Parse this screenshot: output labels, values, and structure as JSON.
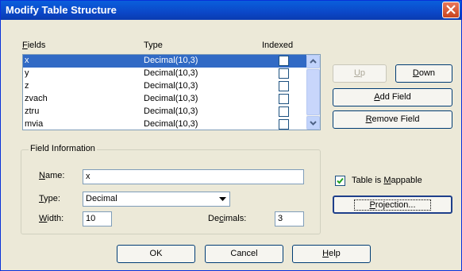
{
  "window": {
    "title": "Modify Table Structure"
  },
  "headers": {
    "fields": "Fields",
    "type": "Type",
    "indexed": "Indexed"
  },
  "fields": [
    {
      "name": "x",
      "type": "Decimal(10,3)",
      "selected": true
    },
    {
      "name": "y",
      "type": "Decimal(10,3)"
    },
    {
      "name": "z",
      "type": "Decimal(10,3)"
    },
    {
      "name": "zvach",
      "type": "Decimal(10,3)"
    },
    {
      "name": "ztru",
      "type": "Decimal(10,3)"
    },
    {
      "name": "mvia",
      "type": "Decimal(10,3)"
    }
  ],
  "buttons": {
    "up": "Up",
    "down": "Down",
    "add_field": "Add Field",
    "remove_field": "Remove Field",
    "projection": "Projection...",
    "ok": "OK",
    "cancel": "Cancel",
    "help": "Help"
  },
  "field_info": {
    "legend": "Field Information",
    "name_label": "Name:",
    "name_value": "x",
    "type_label": "Type:",
    "type_value": "Decimal",
    "width_label": "Width:",
    "width_value": "10",
    "decimals_label": "Decimals:",
    "decimals_value": "3"
  },
  "mappable": {
    "label": "Table is Mappable",
    "checked": true
  },
  "colors": {
    "selection": "#316ac5",
    "titlebar": "#0a5fdc",
    "dialog_bg": "#ece9d8"
  }
}
